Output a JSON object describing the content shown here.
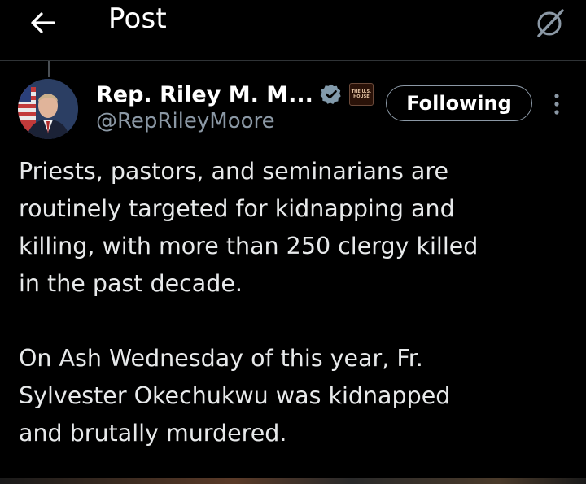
{
  "header": {
    "title": "Post"
  },
  "author": {
    "name": "Rep. Riley M. M...",
    "handle": "@RepRileyMoore",
    "verified": true,
    "affiliation_badge_text": [
      "THE U.S.",
      "HOUSE"
    ]
  },
  "actions": {
    "follow_label": "Following"
  },
  "post": {
    "paragraph1": "Priests, pastors, and seminarians are\nroutinely targeted for kidnapping and\nkilling, with more than 250 clergy killed\nin the past decade.",
    "paragraph2": "On Ash Wednesday of this year, Fr.\nSylvester Okechukwu was kidnapped\nand brutally murdered."
  },
  "colors": {
    "background": "#000000",
    "text": "#e7e9ea",
    "secondary_text": "#8b98a5",
    "verified_badge": "#829aab",
    "border": "#2f3336"
  },
  "icons": {
    "back": "arrow-left-icon",
    "grok": "grok-icon",
    "verified": "verified-badge-icon",
    "more": "more-vertical-icon"
  }
}
